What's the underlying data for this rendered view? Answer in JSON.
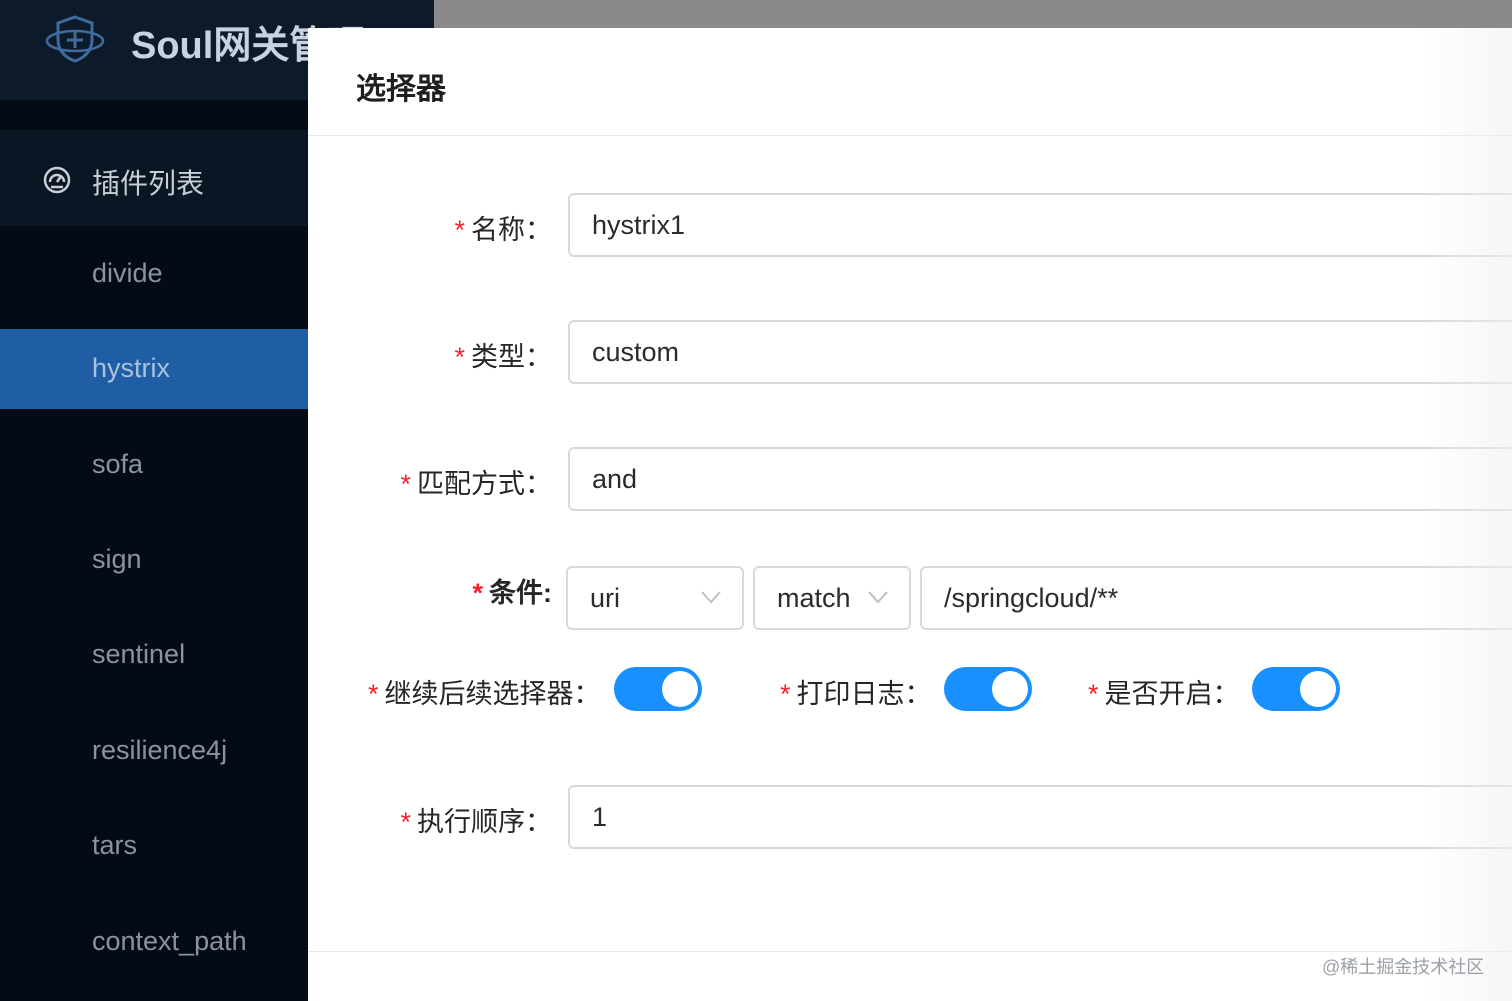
{
  "app": {
    "title": "Soul网关管理"
  },
  "sidebar": {
    "submenu_label": "插件列表",
    "items": [
      {
        "label": "divide"
      },
      {
        "label": "hystrix",
        "active": true
      },
      {
        "label": "sofa"
      },
      {
        "label": "sign"
      },
      {
        "label": "sentinel"
      },
      {
        "label": "resilience4j"
      },
      {
        "label": "tars"
      },
      {
        "label": "context_path"
      }
    ]
  },
  "drawer": {
    "title": "选择器",
    "fields": {
      "name": {
        "label": "名称：",
        "value": "hystrix1"
      },
      "type": {
        "label": "类型：",
        "value": "custom"
      },
      "match_mode": {
        "label": "匹配方式：",
        "value": "and"
      },
      "condition": {
        "label": "条件:",
        "param_type": "uri",
        "operator": "match",
        "value": "/springcloud/**"
      },
      "continued": {
        "label": "继续后续选择器：",
        "on": true
      },
      "logged": {
        "label": "打印日志：",
        "on": true
      },
      "enabled": {
        "label": "是否开启：",
        "on": true
      },
      "sort": {
        "label": "执行顺序：",
        "value": "1"
      }
    },
    "required_mark": "*"
  },
  "watermark": "@稀土掘金技术社区",
  "colors": {
    "primary": "#1890ff",
    "sidebar_active": "#1f5ea5",
    "required": "#f5222d"
  },
  "icons": {
    "logo": "shield-icon",
    "submenu": "dashboard-icon",
    "select_arrow": "chevron-down-icon"
  }
}
